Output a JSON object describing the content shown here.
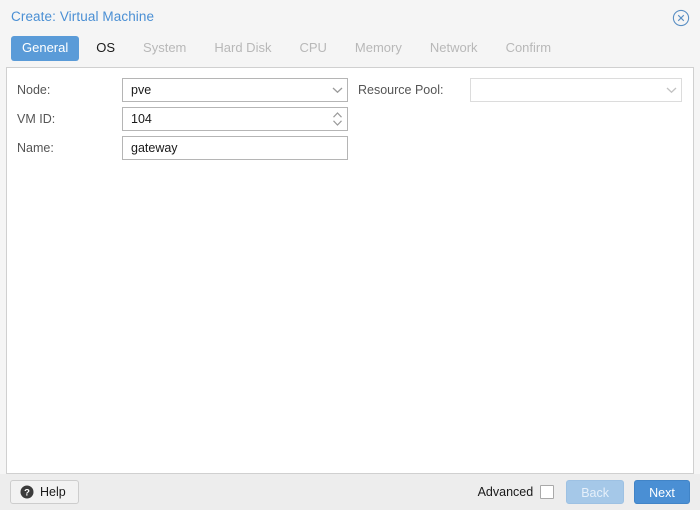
{
  "window": {
    "title": "Create: Virtual Machine",
    "close_icon": "close-circle-icon"
  },
  "tabs": [
    {
      "label": "General",
      "state": "active"
    },
    {
      "label": "OS",
      "state": "enabled"
    },
    {
      "label": "System",
      "state": "disabled"
    },
    {
      "label": "Hard Disk",
      "state": "disabled"
    },
    {
      "label": "CPU",
      "state": "disabled"
    },
    {
      "label": "Memory",
      "state": "disabled"
    },
    {
      "label": "Network",
      "state": "disabled"
    },
    {
      "label": "Confirm",
      "state": "disabled"
    }
  ],
  "form": {
    "left": {
      "node": {
        "label": "Node:",
        "value": "pve",
        "control": "combobox",
        "icon": "chevron-down-icon"
      },
      "vmid": {
        "label": "VM ID:",
        "value": "104",
        "control": "spinner",
        "icon": "spinner-arrows-icon"
      },
      "name": {
        "label": "Name:",
        "value": "gateway",
        "control": "textfield"
      }
    },
    "right": {
      "resource_pool": {
        "label": "Resource Pool:",
        "value": "",
        "control": "combobox",
        "icon": "chevron-down-icon"
      }
    }
  },
  "footer": {
    "help_label": "Help",
    "help_icon": "help-circle-icon",
    "advanced_label": "Advanced",
    "advanced_checked": false,
    "back_label": "Back",
    "next_label": "Next"
  },
  "colors": {
    "accent": "#4a8fd4",
    "tab_active_bg": "#5a9bd8",
    "back_disabled_bg": "#a5c8e8",
    "panel_bg": "#ffffff",
    "chrome_bg": "#f5f5f5",
    "footer_bg": "#ededed"
  }
}
